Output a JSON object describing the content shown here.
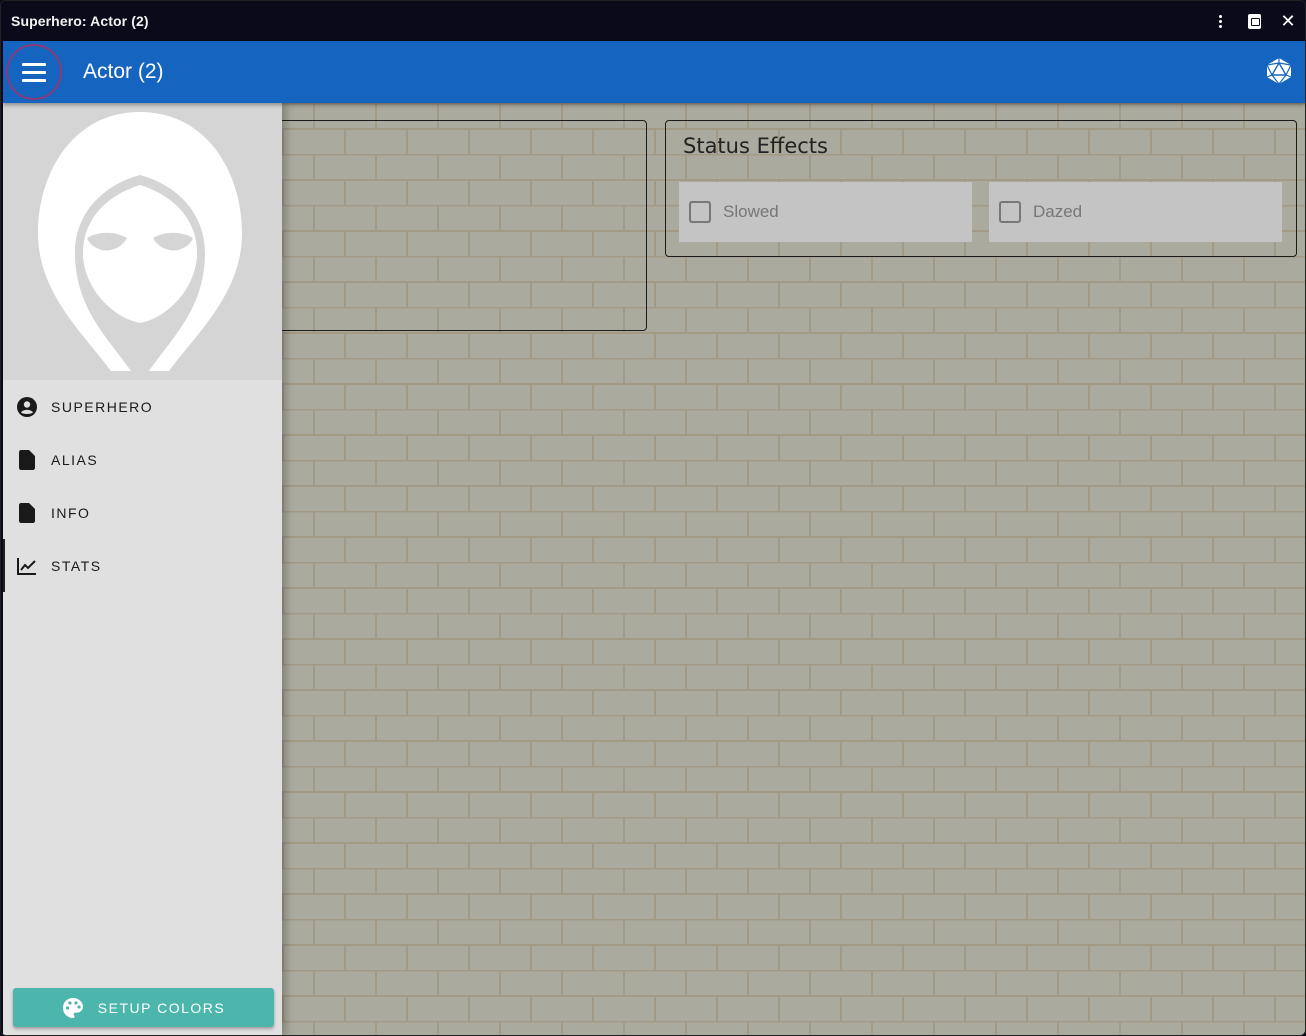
{
  "window": {
    "title": "Superhero: Actor (2)"
  },
  "appbar": {
    "title": "Actor (2)",
    "menu_icon": "hamburger-menu-icon",
    "dice_icon": "d20-icon",
    "color": "#1565c0"
  },
  "status_effects": {
    "heading": "Status Effects",
    "items": [
      {
        "label": "Slowed",
        "checked": false
      },
      {
        "label": "Dazed",
        "checked": false
      }
    ]
  },
  "sidebar": {
    "items": [
      {
        "label": "SUPERHERO",
        "icon": "account-circle-icon",
        "active": false
      },
      {
        "label": "ALIAS",
        "icon": "document-icon",
        "active": false
      },
      {
        "label": "INFO",
        "icon": "document-icon",
        "active": false
      },
      {
        "label": "STATS",
        "icon": "line-chart-icon",
        "active": true
      }
    ],
    "setup_button": {
      "label": "SETUP COLORS",
      "icon": "palette-icon",
      "color": "#4db6ac"
    }
  }
}
